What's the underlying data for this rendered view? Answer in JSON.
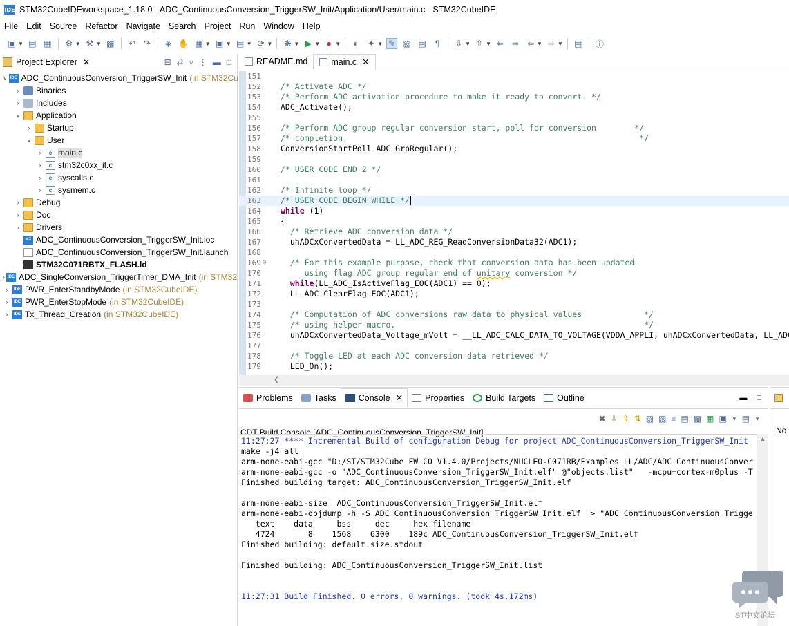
{
  "window": {
    "app_icon": "IDE",
    "title": "STM32CubeIDEworkspace_1.18.0 - ADC_ContinuousConversion_TriggerSW_Init/Application/User/main.c - STM32CubeIDE"
  },
  "menu": [
    "File",
    "Edit",
    "Source",
    "Refactor",
    "Navigate",
    "Search",
    "Project",
    "Run",
    "Window",
    "Help"
  ],
  "explorer": {
    "tab_label": "Project Explorer",
    "tree": [
      {
        "label": "ADC_ContinuousConversion_TriggerSW_Init",
        "suffix": "(in STM32Cu",
        "icon": "project-icon",
        "indent": 0,
        "arrow": "v"
      },
      {
        "label": "Binaries",
        "suffix": "",
        "icon": "binaries-icon",
        "indent": 1,
        "arrow": ">"
      },
      {
        "label": "Includes",
        "suffix": "",
        "icon": "includes-icon",
        "indent": 1,
        "arrow": ">"
      },
      {
        "label": "Application",
        "suffix": "",
        "icon": "folder-icon",
        "indent": 1,
        "arrow": "v"
      },
      {
        "label": "Startup",
        "suffix": "",
        "icon": "folder-icon",
        "indent": 2,
        "arrow": ">"
      },
      {
        "label": "User",
        "suffix": "",
        "icon": "folder-icon",
        "indent": 2,
        "arrow": "v"
      },
      {
        "label": "main.c",
        "suffix": "",
        "icon": "c-file-icon",
        "indent": 3,
        "arrow": ">",
        "selected": true
      },
      {
        "label": "stm32c0xx_it.c",
        "suffix": "",
        "icon": "c-file-icon",
        "indent": 3,
        "arrow": ">"
      },
      {
        "label": "syscalls.c",
        "suffix": "",
        "icon": "c-file-icon",
        "indent": 3,
        "arrow": ">"
      },
      {
        "label": "sysmem.c",
        "suffix": "",
        "icon": "c-file-icon",
        "indent": 3,
        "arrow": ">"
      },
      {
        "label": "Debug",
        "suffix": "",
        "icon": "folder-icon",
        "indent": 1,
        "arrow": ">"
      },
      {
        "label": "Doc",
        "suffix": "",
        "icon": "folder-icon",
        "indent": 1,
        "arrow": ">"
      },
      {
        "label": "Drivers",
        "suffix": "",
        "icon": "folder-icon",
        "indent": 1,
        "arrow": ">"
      },
      {
        "label": "ADC_ContinuousConversion_TriggerSW_Init.ioc",
        "suffix": "",
        "icon": "mx-icon",
        "indent": 1,
        "arrow": ""
      },
      {
        "label": "ADC_ContinuousConversion_TriggerSW_Init.launch",
        "suffix": "",
        "icon": "launch-icon",
        "indent": 1,
        "arrow": ""
      },
      {
        "label": "STM32C071RBTX_FLASH.ld",
        "suffix": "",
        "icon": "linker-icon",
        "indent": 1,
        "arrow": "",
        "bold": true
      },
      {
        "label": "ADC_SingleConversion_TriggerTimer_DMA_Init",
        "suffix": "(in STM32",
        "icon": "project-icon",
        "indent": 0,
        "arrow": ">"
      },
      {
        "label": "PWR_EnterStandbyMode",
        "suffix": "(in STM32CubeIDE)",
        "icon": "project-icon",
        "indent": 0,
        "arrow": ">"
      },
      {
        "label": "PWR_EnterStopMode",
        "suffix": "(in STM32CubeIDE)",
        "icon": "project-icon",
        "indent": 0,
        "arrow": ">"
      },
      {
        "label": "Tx_Thread_Creation",
        "suffix": "(in STM32CubeIDE)",
        "icon": "project-icon",
        "indent": 0,
        "arrow": ">"
      }
    ]
  },
  "editor": {
    "tabs": [
      {
        "label": "README.md",
        "active": false
      },
      {
        "label": "main.c",
        "active": true
      }
    ],
    "lines": [
      {
        "n": "151",
        "segs": [
          {
            "t": "",
            "c": ""
          }
        ]
      },
      {
        "n": "152",
        "segs": [
          {
            "t": "/* Activate ADC */",
            "c": "cm"
          }
        ]
      },
      {
        "n": "153",
        "segs": [
          {
            "t": "/* Perform ADC activation procedure to make it ready to convert. */",
            "c": "cm"
          }
        ]
      },
      {
        "n": "154",
        "segs": [
          {
            "t": "ADC_Activate();",
            "c": ""
          }
        ]
      },
      {
        "n": "155",
        "segs": [
          {
            "t": "",
            "c": ""
          }
        ]
      },
      {
        "n": "156",
        "segs": [
          {
            "t": "/* Perform ADC group regular conversion start, poll for conversion        */",
            "c": "cm"
          }
        ]
      },
      {
        "n": "157",
        "segs": [
          {
            "t": "/* completion.                                                             */",
            "c": "cm"
          }
        ]
      },
      {
        "n": "158",
        "segs": [
          {
            "t": "ConversionStartPoll_ADC_GrpRegular();",
            "c": ""
          }
        ]
      },
      {
        "n": "159",
        "segs": [
          {
            "t": "",
            "c": ""
          }
        ]
      },
      {
        "n": "160",
        "segs": [
          {
            "t": "/* USER CODE END 2 */",
            "c": "cm"
          }
        ]
      },
      {
        "n": "161",
        "segs": [
          {
            "t": "",
            "c": ""
          }
        ]
      },
      {
        "n": "162",
        "segs": [
          {
            "t": "/* Infinite loop */",
            "c": "cm"
          }
        ]
      },
      {
        "n": "163",
        "segs": [
          {
            "t": "/* USER CODE BEGIN WHILE */",
            "c": "cm"
          }
        ],
        "current": true
      },
      {
        "n": "164",
        "segs": [
          {
            "t": "while",
            "c": "kw"
          },
          {
            "t": " (1)",
            "c": ""
          }
        ]
      },
      {
        "n": "165",
        "segs": [
          {
            "t": "{",
            "c": ""
          }
        ]
      },
      {
        "n": "166",
        "segs": [
          {
            "t": "  /* Retrieve ADC conversion data */",
            "c": "cm"
          }
        ]
      },
      {
        "n": "167",
        "segs": [
          {
            "t": "  uhADCxConvertedData = LL_ADC_REG_ReadConversionData32(ADC1);",
            "c": ""
          }
        ]
      },
      {
        "n": "168",
        "segs": [
          {
            "t": "",
            "c": ""
          }
        ]
      },
      {
        "n": "169",
        "segs": [
          {
            "t": "  /* For this example purpose, check that conversion data has been updated",
            "c": "cm"
          }
        ],
        "fold": true
      },
      {
        "n": "170",
        "segs": [
          {
            "t": "     using flag ADC group regular end of ",
            "c": "cm"
          },
          {
            "t": "unitary",
            "c": "cm squig"
          },
          {
            "t": " conversion */",
            "c": "cm"
          }
        ]
      },
      {
        "n": "171",
        "segs": [
          {
            "t": "  ",
            "c": ""
          },
          {
            "t": "while",
            "c": "kw"
          },
          {
            "t": "(LL_ADC_IsActiveFlag_EOC(ADC1) == 0);",
            "c": ""
          }
        ]
      },
      {
        "n": "172",
        "segs": [
          {
            "t": "  LL_ADC_ClearFlag_EOC(ADC1);",
            "c": ""
          }
        ]
      },
      {
        "n": "173",
        "segs": [
          {
            "t": "",
            "c": ""
          }
        ]
      },
      {
        "n": "174",
        "segs": [
          {
            "t": "  /* Computation of ADC conversions raw data to physical values             */",
            "c": "cm"
          }
        ]
      },
      {
        "n": "175",
        "segs": [
          {
            "t": "  /* using helper macro.                                                    */",
            "c": "cm"
          }
        ]
      },
      {
        "n": "176",
        "segs": [
          {
            "t": "  uhADCxConvertedData_Voltage_mVolt = __LL_ADC_CALC_DATA_TO_VOLTAGE(VDDA_APPLI, uhADCxConvertedData, LL_ADC_",
            "c": ""
          }
        ]
      },
      {
        "n": "177",
        "segs": [
          {
            "t": "",
            "c": ""
          }
        ]
      },
      {
        "n": "178",
        "segs": [
          {
            "t": "  /* Toggle LED at each ADC conversion data retrieved */",
            "c": "cm"
          }
        ]
      },
      {
        "n": "179",
        "segs": [
          {
            "t": "  LED_On();",
            "c": ""
          }
        ]
      }
    ]
  },
  "bottom": {
    "tabs": [
      {
        "label": "Problems",
        "active": false,
        "icon": "problems-icon"
      },
      {
        "label": "Tasks",
        "active": false,
        "icon": "tasks-icon"
      },
      {
        "label": "Console",
        "active": true,
        "icon": "console-icon"
      },
      {
        "label": "Properties",
        "active": false,
        "icon": "properties-icon"
      },
      {
        "label": "Build Targets",
        "active": false,
        "icon": "build-targets-icon"
      },
      {
        "label": "Outline",
        "active": false,
        "icon": "outline-icon"
      }
    ],
    "console_name": "CDT Build Console [ADC_ContinuousConversion_TriggerSW_Init]",
    "console_lines": [
      {
        "t": "11:27:27 **** Incremental Build of configuration Debug for project ADC_ContinuousConversion_TriggerSW_Init",
        "c": "blue"
      },
      {
        "t": "make -j4 all",
        "c": ""
      },
      {
        "t": "arm-none-eabi-gcc \"D:/ST/STM32Cube_FW_C0_V1.4.0/Projects/NUCLEO-C071RB/Examples_LL/ADC/ADC_ContinuousConver",
        "c": ""
      },
      {
        "t": "arm-none-eabi-gcc -o \"ADC_ContinuousConversion_TriggerSW_Init.elf\" @\"objects.list\"   -mcpu=cortex-m0plus -T",
        "c": ""
      },
      {
        "t": "Finished building target: ADC_ContinuousConversion_TriggerSW_Init.elf",
        "c": ""
      },
      {
        "t": "",
        "c": ""
      },
      {
        "t": "arm-none-eabi-size  ADC_ContinuousConversion_TriggerSW_Init.elf",
        "c": ""
      },
      {
        "t": "arm-none-eabi-objdump -h -S ADC_ContinuousConversion_TriggerSW_Init.elf  > \"ADC_ContinuousConversion_Trigge",
        "c": ""
      },
      {
        "t": "   text    data     bss     dec     hex filename",
        "c": ""
      },
      {
        "t": "   4724       8    1568    6300    189c ADC_ContinuousConversion_TriggerSW_Init.elf",
        "c": ""
      },
      {
        "t": "Finished building: default.size.stdout",
        "c": ""
      },
      {
        "t": "",
        "c": ""
      },
      {
        "t": "Finished building: ADC_ContinuousConversion_TriggerSW_Init.list",
        "c": ""
      },
      {
        "t": "",
        "c": ""
      },
      {
        "t": "",
        "c": ""
      },
      {
        "t": "11:27:31 Build Finished. 0 errors, 0 warnings. (took 4s.172ms)",
        "c": "blue"
      }
    ]
  },
  "right_panel": {
    "text": "No"
  },
  "watermark": {
    "text": "ST中文论坛"
  },
  "colors": {
    "comment": "#3f7f5f",
    "keyword": "#7f0055",
    "console_blue": "#1c39c8",
    "current_line": "#e8f2fe"
  }
}
